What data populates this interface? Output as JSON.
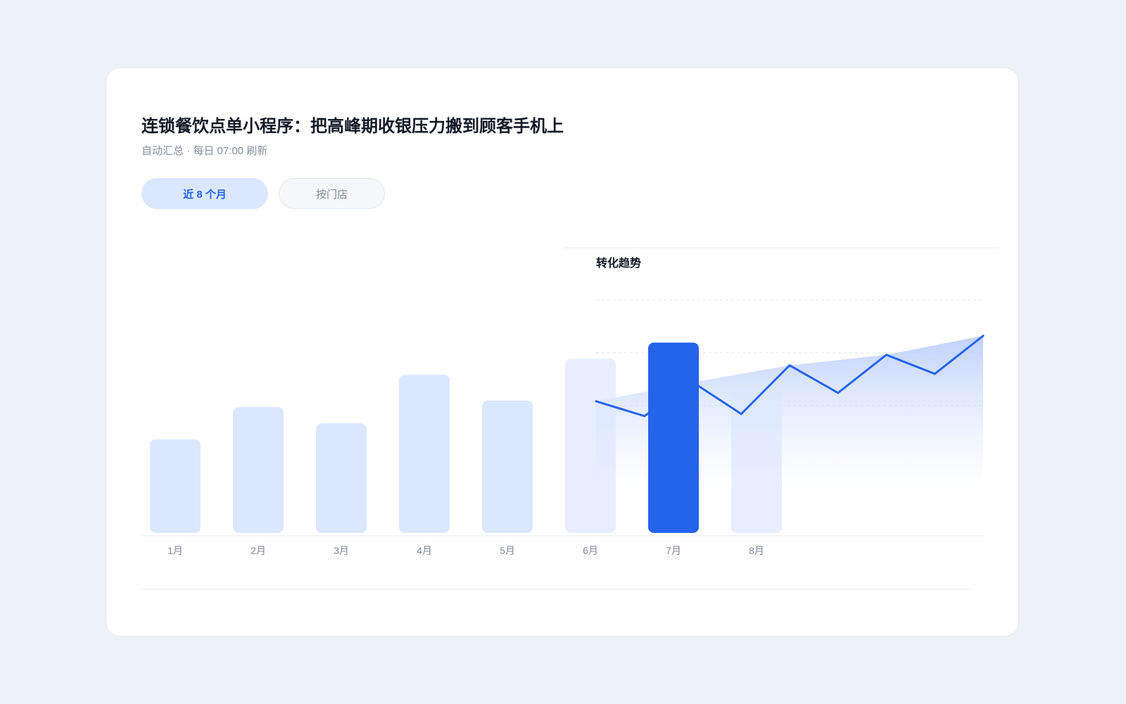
{
  "card": {
    "title": "连锁餐饮点单小程序：把高峰期收银压力搬到顾客手机上",
    "subtitle": "自动汇总 · 每日 07:00 刷新",
    "tabs": [
      {
        "label": "近 8 个月",
        "active": true
      },
      {
        "label": "按门店",
        "active": false
      }
    ]
  },
  "colors": {
    "accent": "#2563eb",
    "bar": "#dbe7ff",
    "page_bg": "#edf1f8",
    "line": "#2563eb"
  },
  "chart_data": [
    {
      "type": "bar",
      "title": "",
      "categories": [
        "1月",
        "2月",
        "3月",
        "4月",
        "5月",
        "6月",
        "7月",
        "8月"
      ],
      "values": [
        29,
        39,
        34,
        49,
        41,
        54,
        59,
        45
      ],
      "highlight": "7月",
      "ylim": [
        0,
        60
      ],
      "grid": false
    },
    {
      "type": "line",
      "title": "转化趋势",
      "values": [
        42,
        35,
        51,
        36,
        59,
        46,
        64,
        55,
        73
      ],
      "ylim": [
        0,
        100
      ],
      "area_fill": true,
      "grid": true
    }
  ]
}
